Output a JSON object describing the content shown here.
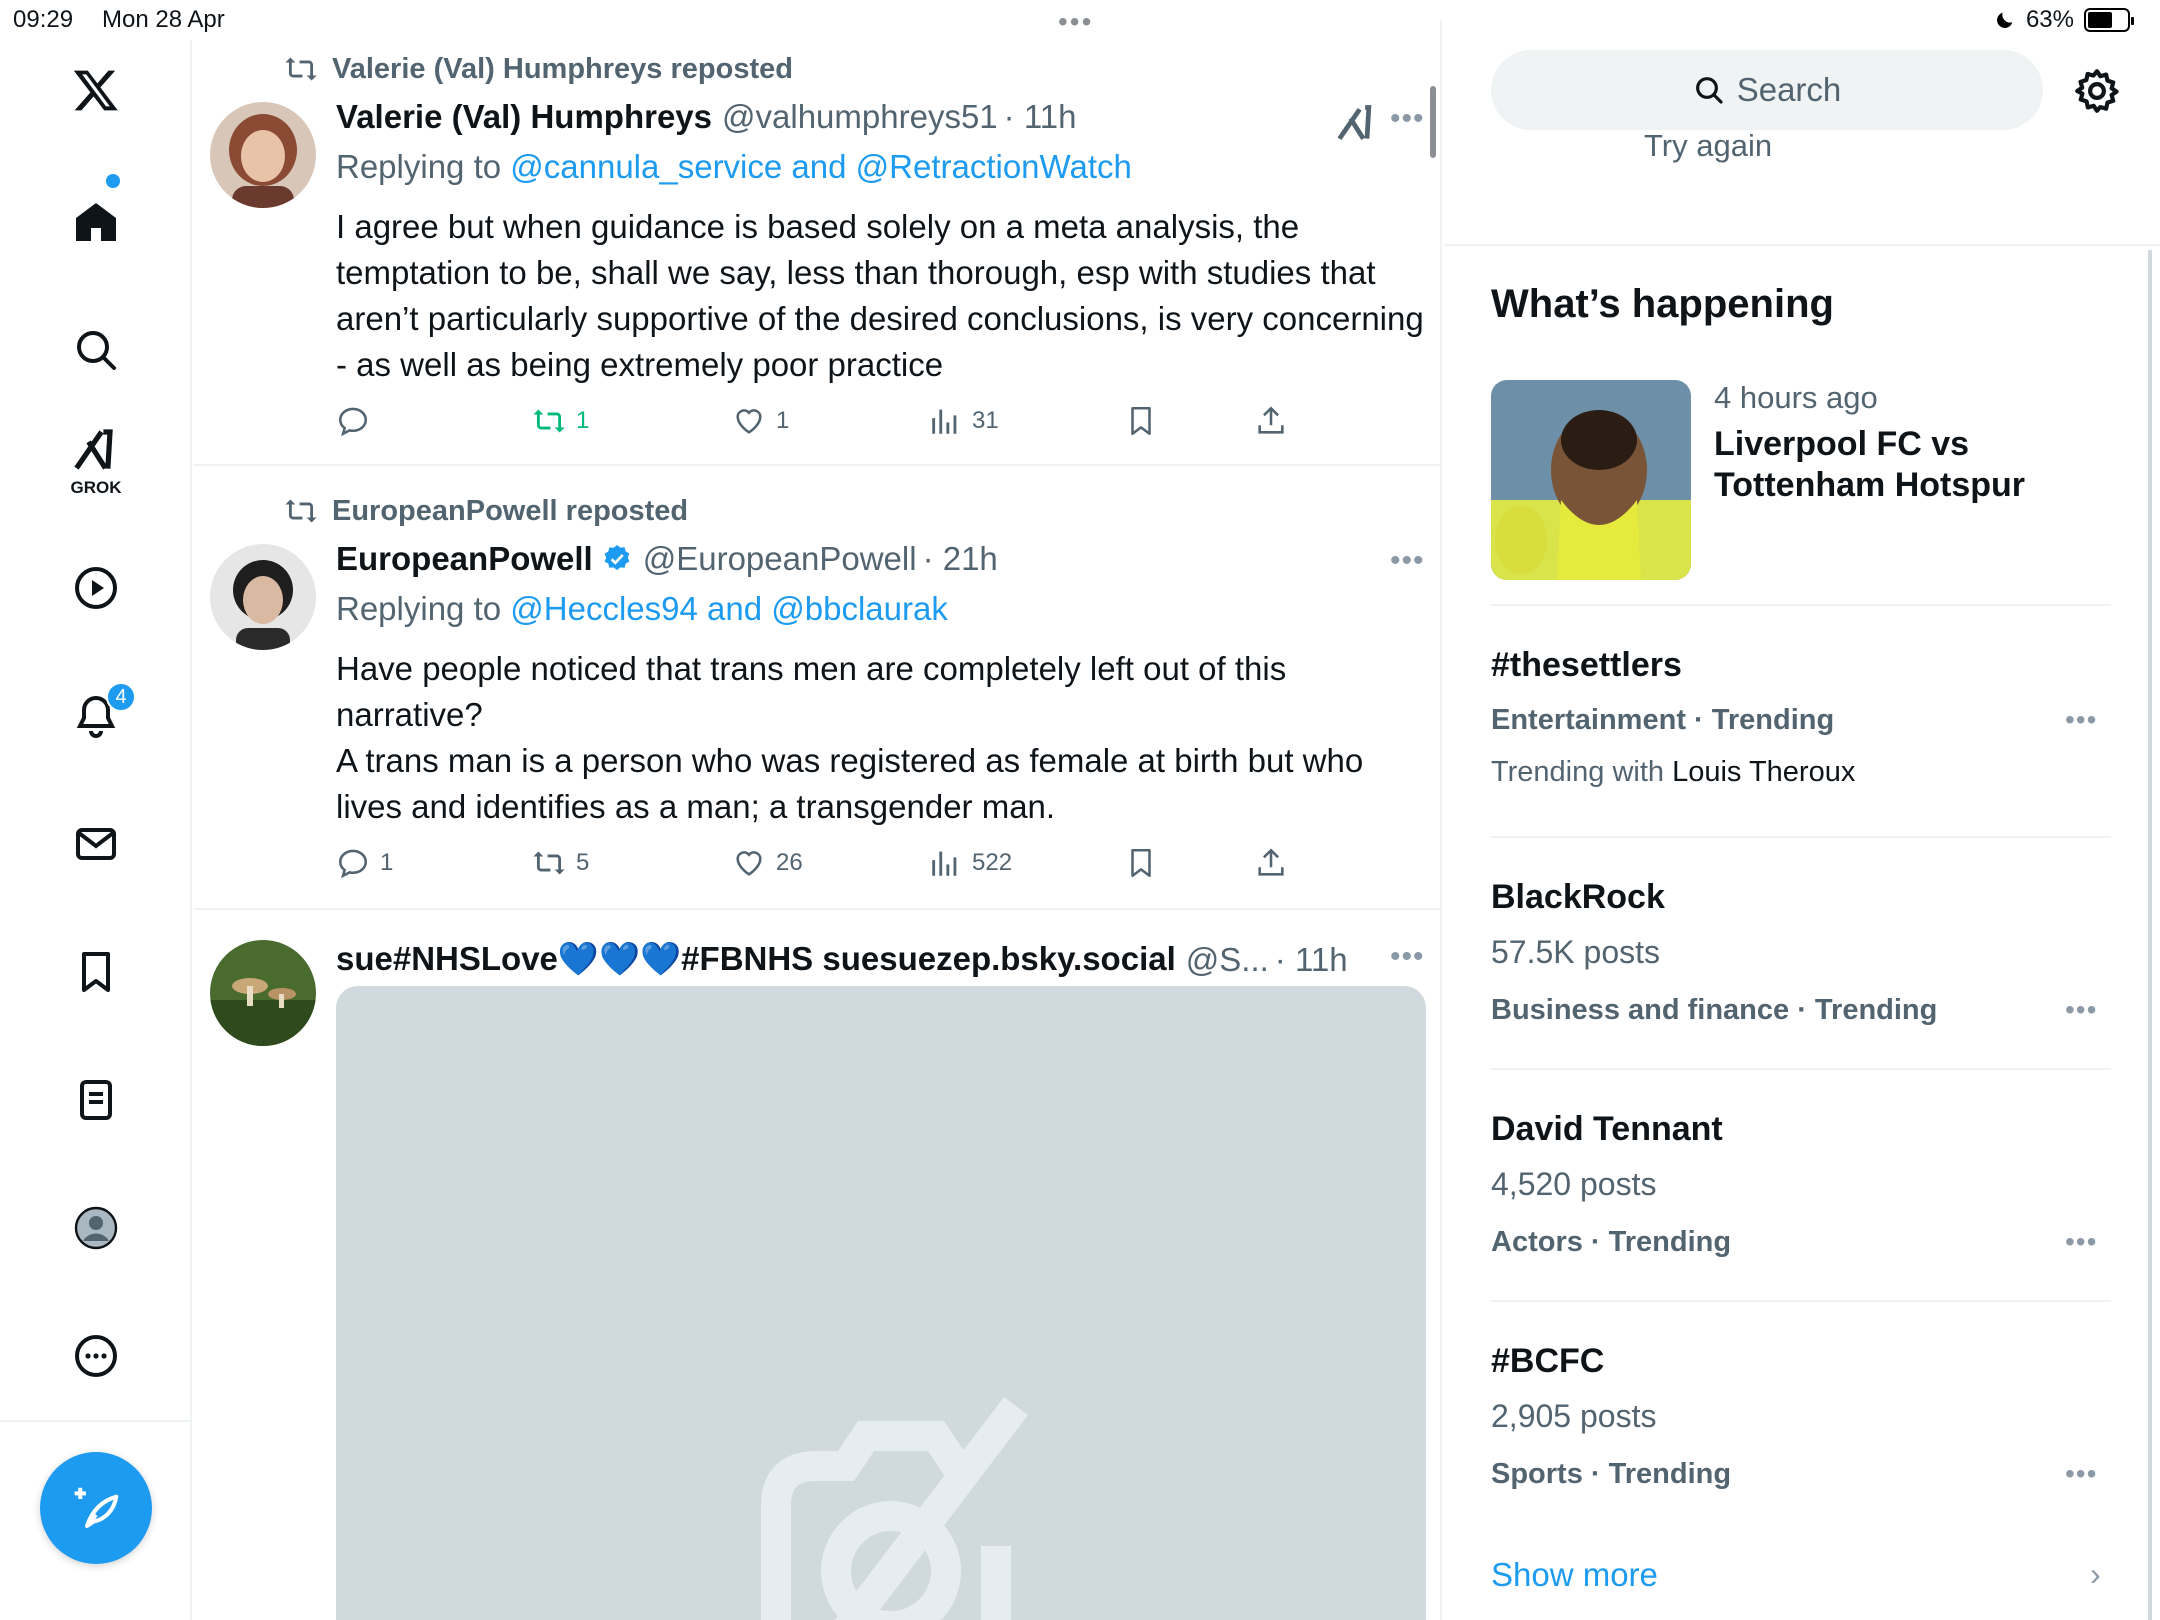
{
  "status_bar": {
    "time": "09:29",
    "date": "Mon 28 Apr",
    "battery": "63%",
    "battery_level": 0.63,
    "dots": "•••"
  },
  "nav": {
    "grok_label": "GROK",
    "notifications_badge": "4",
    "icons": [
      "x-logo-icon",
      "home-icon",
      "search-icon",
      "grok-icon",
      "video-icon",
      "notifications-icon",
      "messages-icon",
      "bookmarks-icon",
      "lists-icon",
      "profile-icon",
      "more-icon"
    ]
  },
  "posts": [
    {
      "repost_label": "Valerie (Val) Humphreys reposted",
      "name": "Valerie (Val) Humphreys",
      "handle": "@valhumphreys51",
      "time": "· 11h",
      "replying_prefix": "Replying to ",
      "replying_mentions": "@cannula_service and @RetractionWatch",
      "text": "I agree but when guidance is based solely on a meta analysis, the temptation to be, shall we say, less than thorough, esp with studies that aren’t particularly supportive of the desired conclusions, is very concerning - as well as being extremely poor practice",
      "replies": "",
      "reposts": "1",
      "likes": "1",
      "views": "31"
    },
    {
      "repost_label": "EuropeanPowell reposted",
      "name": "EuropeanPowell",
      "handle": "@EuropeanPowell",
      "time": "· 21h",
      "replying_prefix": "Replying to ",
      "replying_mentions": "@Heccles94 and @bbclaurak",
      "text_line1": "Have people noticed that trans men are completely left out of this narrative?",
      "text_line2": "A trans man is a person who was registered as female at birth but who lives and identifies as a man; a transgender man.",
      "replies": "1",
      "reposts": "5",
      "likes": "26",
      "views": "522"
    },
    {
      "name": "sue#NHSLove💙💙💙#FBNHS suesuezep.bsky.social",
      "handle": "@S...",
      "time": "· 11h"
    }
  ],
  "right": {
    "search_placeholder": "Search",
    "try_again": "Try again",
    "whats_happening": "What’s happening",
    "news": {
      "time": "4 hours ago",
      "headline": "Liverpool FC vs Tottenham Hotspur"
    },
    "trends": [
      {
        "title": "#thesettlers",
        "meta": "Entertainment · Trending",
        "with_prefix": "Trending with ",
        "with_name": "Louis Theroux"
      },
      {
        "title": "BlackRock",
        "posts": "57.5K posts",
        "meta": "Business and finance · Trending"
      },
      {
        "title": "David Tennant",
        "posts": "4,520 posts",
        "meta": "Actors · Trending"
      },
      {
        "title": "#BCFC",
        "posts": "2,905 posts",
        "meta": "Sports · Trending"
      }
    ],
    "show_more": "Show more",
    "more_glyph": "•••",
    "chevron": "›"
  },
  "colors": {
    "accent": "#1d9bf0",
    "repost_green": "#00ba7c",
    "secondary_text": "#536471",
    "border": "#eff3f4"
  }
}
